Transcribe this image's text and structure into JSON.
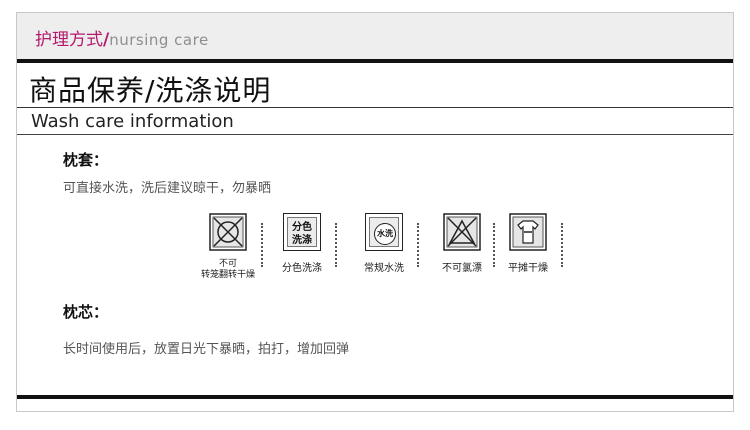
{
  "header": {
    "title_cn": "护理方式",
    "separator": "/",
    "title_en": "nursing care"
  },
  "main_title": "商品保养/洗涤说明",
  "sub_title": "Wash care information",
  "pillowcase": {
    "heading": "枕套：",
    "text": "可直接水洗，洗后建议晾干，勿暴晒"
  },
  "icons": [
    {
      "name": "no-tumble-dry-icon",
      "label_line1": "不可",
      "label_line2": "转笼翻转干燥"
    },
    {
      "name": "wash-separately-icon",
      "glyph_line1": "分色",
      "glyph_line2": "洗涤",
      "label": "分色洗涤"
    },
    {
      "name": "normal-wash-icon",
      "glyph": "水洗",
      "label": "常规水洗"
    },
    {
      "name": "no-bleach-icon",
      "label": "不可氯漂"
    },
    {
      "name": "flat-dry-icon",
      "label": "平摊干燥"
    }
  ],
  "core": {
    "heading": "枕芯：",
    "text": "长时间使用后，放置日光下暴晒，拍打，增加回弹"
  }
}
